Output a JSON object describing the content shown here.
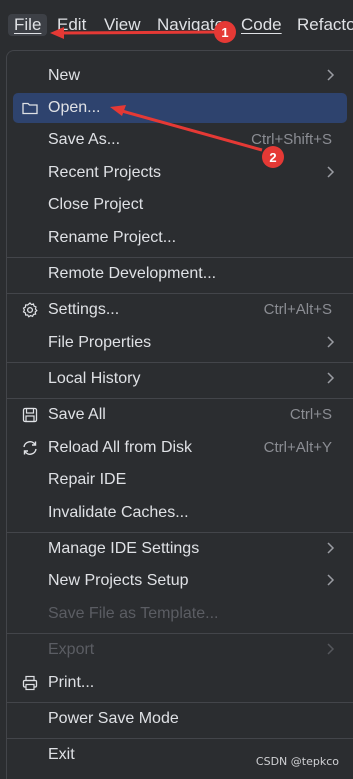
{
  "menubar": {
    "items": [
      {
        "label": "File",
        "mnemonic": "F"
      },
      {
        "label": "Edit"
      },
      {
        "label": "View"
      },
      {
        "label": "Navigate"
      },
      {
        "label": "Code"
      },
      {
        "label": "Refactor"
      }
    ]
  },
  "file_menu": {
    "items": [
      {
        "label": "New",
        "submenu": true
      },
      {
        "label": "Open...",
        "selected": true,
        "icon": "folder-icon"
      },
      {
        "label": "Save As...",
        "shortcut": "Ctrl+Shift+S"
      },
      {
        "label": "Recent Projects",
        "submenu": true
      },
      {
        "label": "Close Project"
      },
      {
        "label": "Rename Project..."
      },
      {
        "label": "Remote Development..."
      },
      {
        "label": "Settings...",
        "shortcut": "Ctrl+Alt+S",
        "icon": "gear-icon"
      },
      {
        "label": "File Properties",
        "submenu": true
      },
      {
        "label": "Local History",
        "submenu": true
      },
      {
        "label": "Save All",
        "shortcut": "Ctrl+S",
        "icon": "save-icon"
      },
      {
        "label": "Reload All from Disk",
        "shortcut": "Ctrl+Alt+Y",
        "icon": "reload-icon"
      },
      {
        "label": "Repair IDE"
      },
      {
        "label": "Invalidate Caches..."
      },
      {
        "label": "Manage IDE Settings",
        "submenu": true
      },
      {
        "label": "New Projects Setup",
        "submenu": true
      },
      {
        "label": "Save File as Template...",
        "disabled": true
      },
      {
        "label": "Export",
        "disabled": true,
        "submenu": true
      },
      {
        "label": "Print...",
        "icon": "printer-icon"
      },
      {
        "label": "Power Save Mode"
      },
      {
        "label": "Exit"
      }
    ]
  },
  "annotations": {
    "badge_1": "1",
    "badge_2": "2",
    "color": "#e53935"
  },
  "watermark": "CSDN @tepkco",
  "colors": {
    "background": "#2b2d30",
    "selection": "#2e436e",
    "text": "#dfe1e5",
    "shortcut": "#8b8d93",
    "disabled": "#5b5d63"
  }
}
